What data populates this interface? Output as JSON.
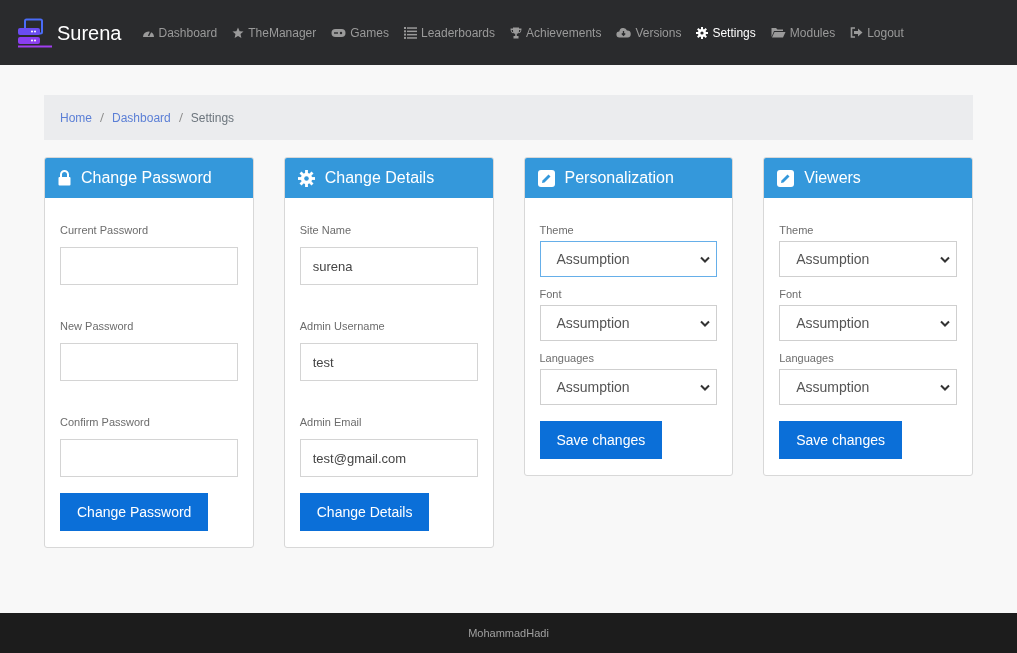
{
  "brand": {
    "name": "Surena"
  },
  "nav": [
    {
      "label": "Dashboard",
      "selected": false
    },
    {
      "label": "TheManager",
      "selected": false
    },
    {
      "label": "Games",
      "selected": false
    },
    {
      "label": "Leaderboards",
      "selected": false
    },
    {
      "label": "Achievements",
      "selected": false
    },
    {
      "label": "Versions",
      "selected": false
    },
    {
      "label": "Settings",
      "selected": true
    },
    {
      "label": "Modules",
      "selected": false
    },
    {
      "label": "Logout",
      "selected": false
    }
  ],
  "breadcrumb": [
    {
      "label": "Home",
      "link": true
    },
    {
      "label": "Dashboard",
      "link": true
    },
    {
      "label": "Settings",
      "link": false
    }
  ],
  "cards": [
    {
      "title": "Change Password",
      "kind": "inputs",
      "fields": [
        {
          "label": "Current Password"
        },
        {
          "label": "New Password"
        },
        {
          "label": "Confirm Password"
        }
      ],
      "button": "Change Password"
    },
    {
      "title": "Change Details",
      "kind": "inputs",
      "fields": [
        {
          "label": "Site Name",
          "value": "surena"
        },
        {
          "label": "Admin Username",
          "value": "test"
        },
        {
          "label": "Admin Email",
          "value": "test@gmail.com"
        }
      ],
      "button": "Change Details"
    },
    {
      "title": "Personalization",
      "kind": "selects",
      "fields": [
        {
          "label": "Theme",
          "value": "Assumption",
          "focused": true
        },
        {
          "label": "Font",
          "value": "Assumption",
          "focused": false
        },
        {
          "label": "Languages",
          "value": "Assumption",
          "focused": false
        }
      ],
      "button": "Save changes"
    },
    {
      "title": "Viewers",
      "kind": "selects",
      "fields": [
        {
          "label": "Theme",
          "value": "Assumption",
          "focused": false
        },
        {
          "label": "Font",
          "value": "Assumption",
          "focused": false
        },
        {
          "label": "Languages",
          "value": "Assumption",
          "focused": false
        }
      ],
      "button": "Save changes"
    }
  ],
  "footer": {
    "text": "MohammadHadi"
  }
}
